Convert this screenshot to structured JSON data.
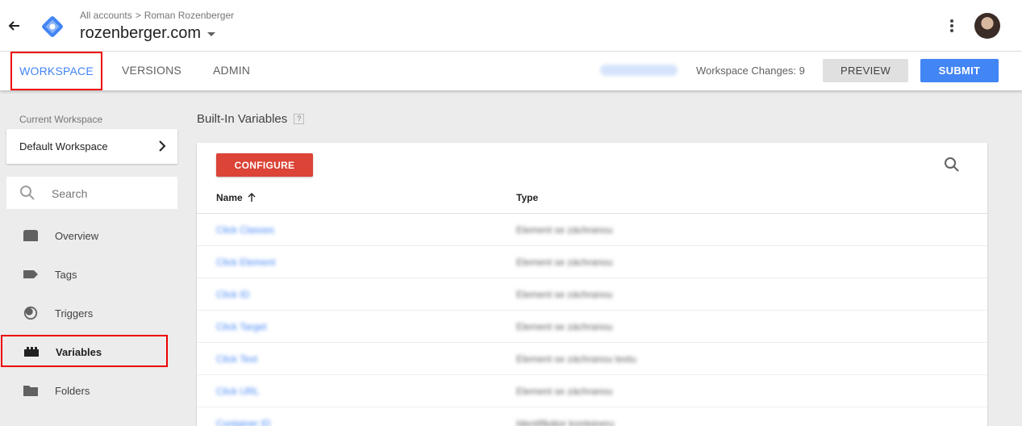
{
  "header": {
    "breadcrumb_account": "All accounts",
    "breadcrumb_separator": ">",
    "breadcrumb_user": "Roman Rozenberger",
    "container_name": "rozenberger.com"
  },
  "tabs": {
    "workspace": "WORKSPACE",
    "versions": "VERSIONS",
    "admin": "ADMIN"
  },
  "toolbar": {
    "workspace_changes": "Workspace Changes: 9",
    "preview_label": "PREVIEW",
    "submit_label": "SUBMIT"
  },
  "sidebar": {
    "current_workspace_label": "Current Workspace",
    "current_workspace_name": "Default Workspace",
    "search_placeholder": "Search",
    "items": [
      {
        "label": "Overview",
        "icon": "overview-icon"
      },
      {
        "label": "Tags",
        "icon": "tag-icon"
      },
      {
        "label": "Triggers",
        "icon": "trigger-icon"
      },
      {
        "label": "Variables",
        "icon": "variables-icon",
        "active": true
      },
      {
        "label": "Folders",
        "icon": "folder-icon"
      }
    ]
  },
  "main": {
    "title": "Built-In Variables",
    "help": "?",
    "configure_label": "CONFIGURE",
    "columns": {
      "name": "Name",
      "type": "Type"
    },
    "rows": [
      {
        "name": "Click Classes",
        "type": "Element se záchranou"
      },
      {
        "name": "Click Element",
        "type": "Element se záchranou"
      },
      {
        "name": "Click ID",
        "type": "Element se záchranou"
      },
      {
        "name": "Click Target",
        "type": "Element se záchranou"
      },
      {
        "name": "Click Text",
        "type": "Element se záchranou textu"
      },
      {
        "name": "Click URL",
        "type": "Element se záchranou"
      },
      {
        "name": "Container ID",
        "type": "Identifikátor kontejneru"
      }
    ]
  },
  "colors": {
    "accent": "#4285f4",
    "configure": "#db4437",
    "highlight_border": "#ee0000"
  }
}
